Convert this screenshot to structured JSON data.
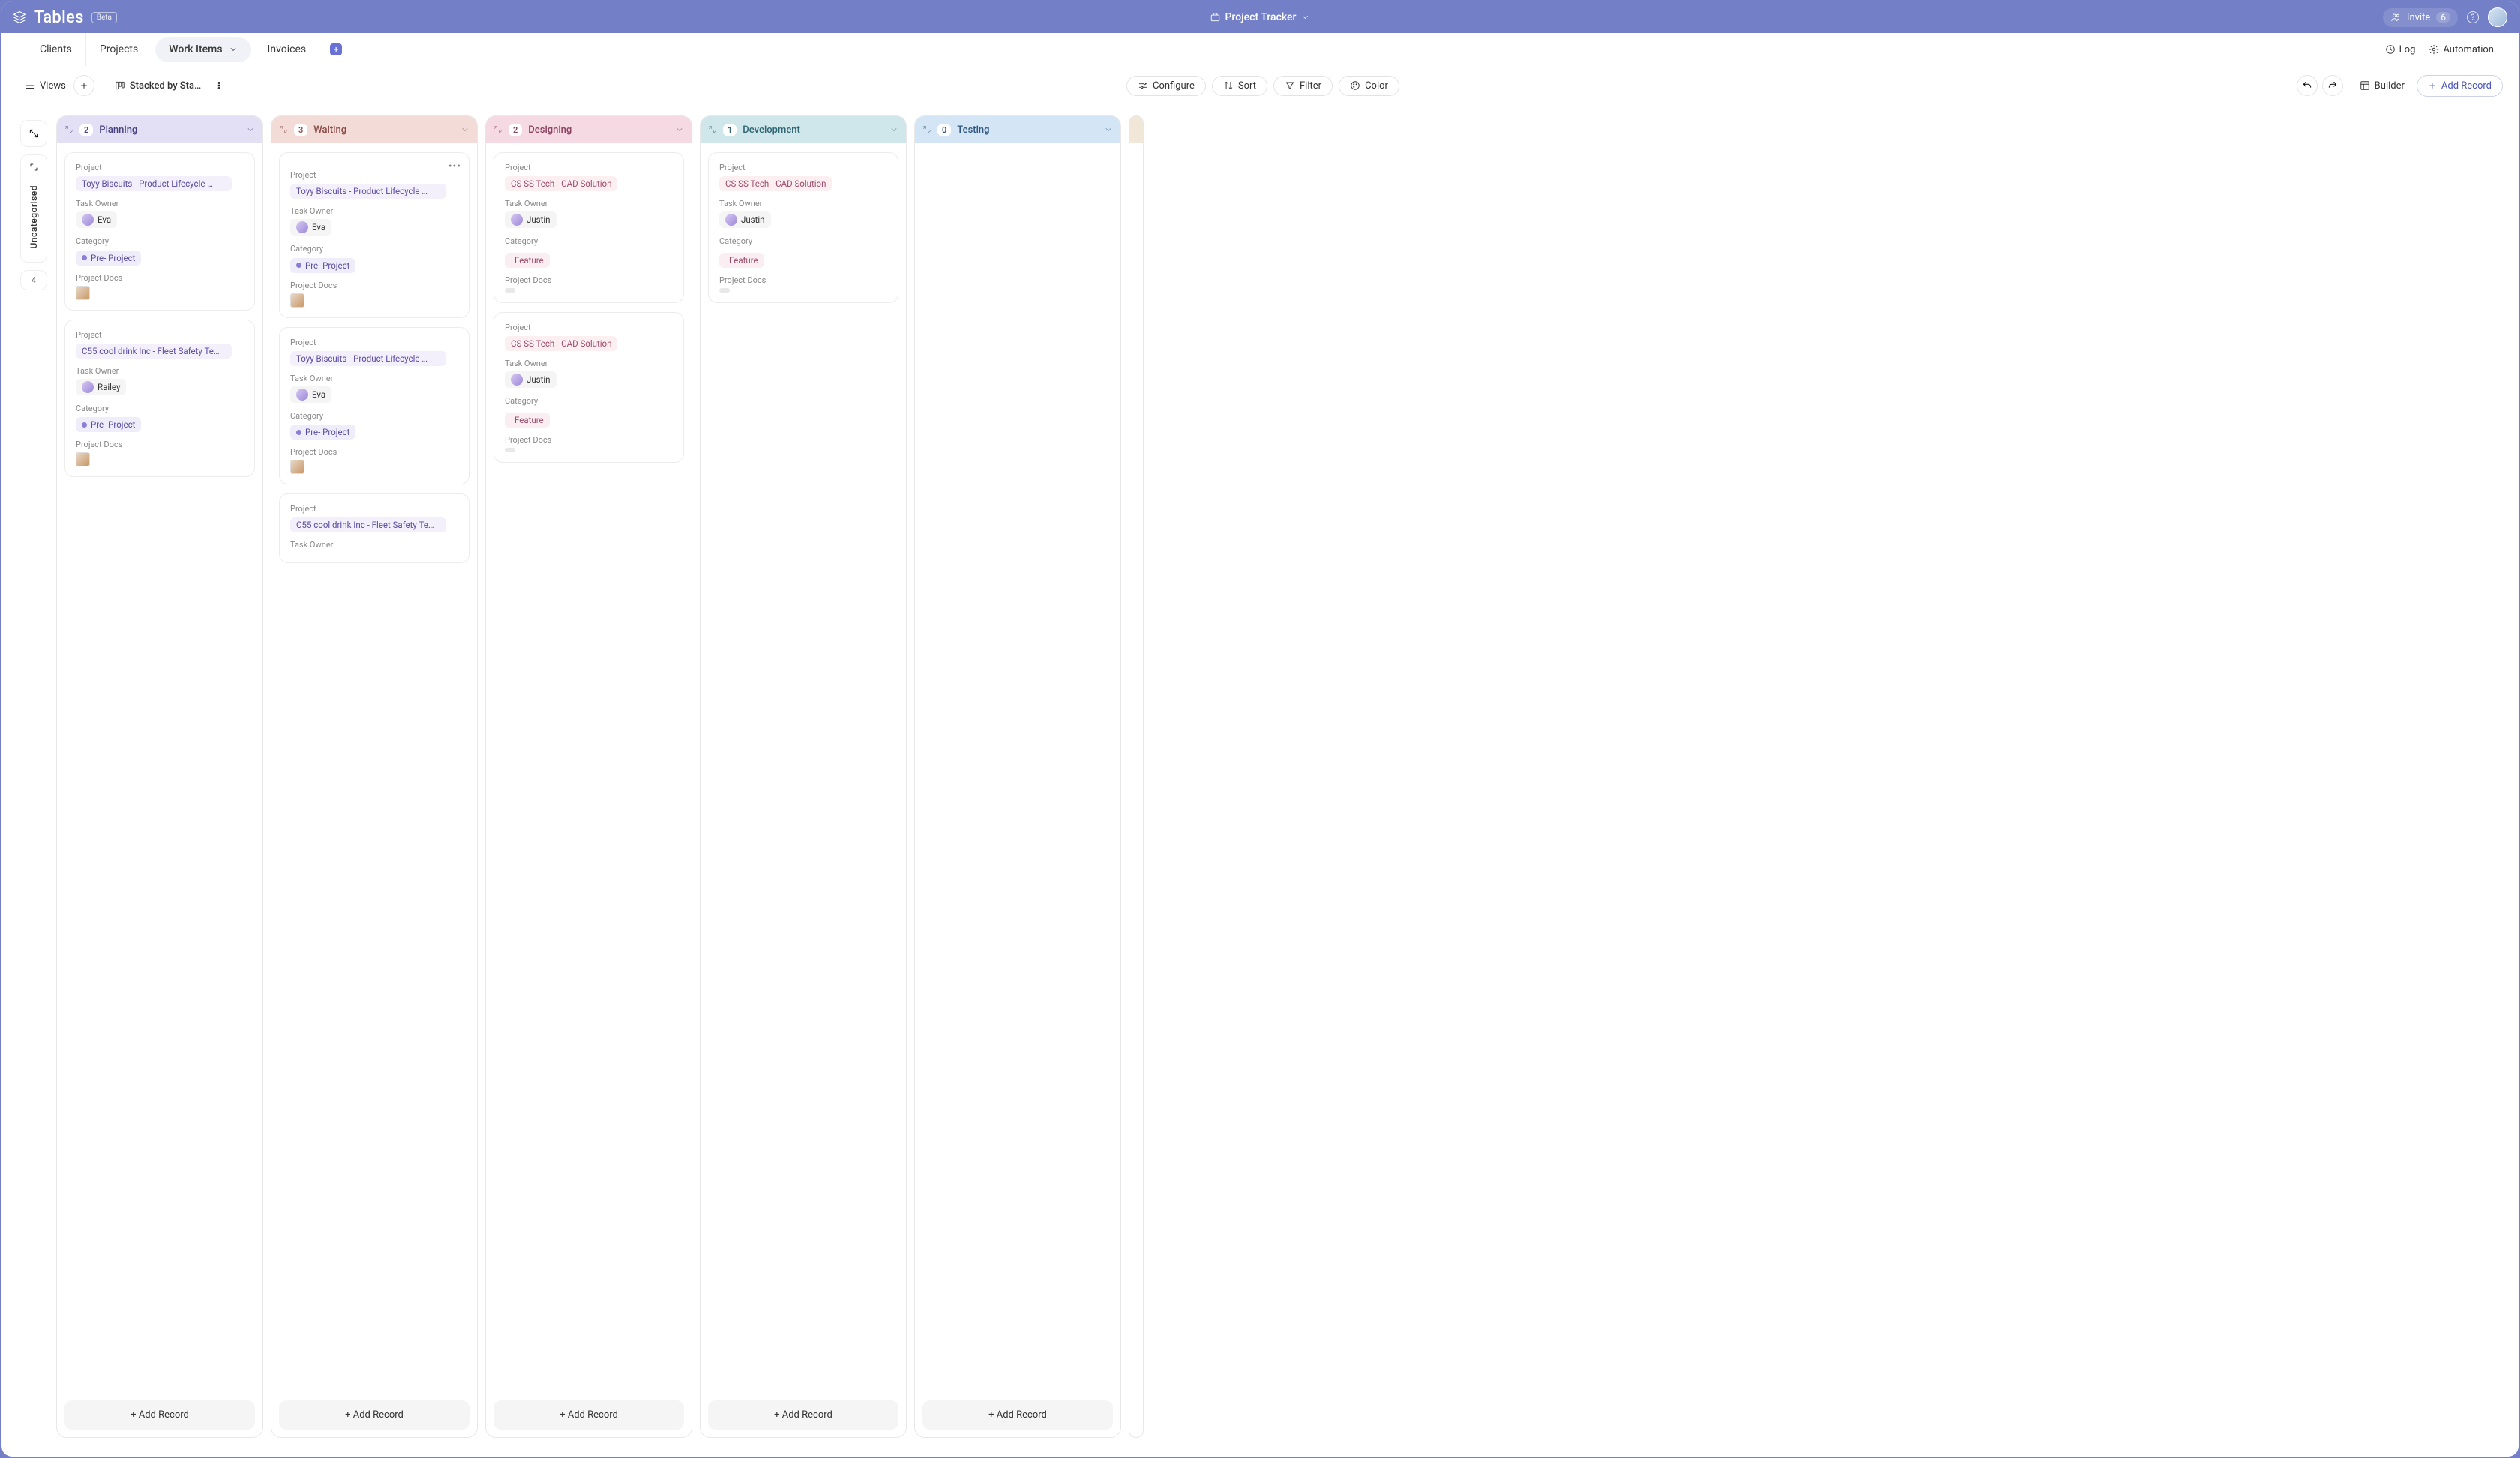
{
  "header": {
    "app_title": "Tables",
    "beta": "Beta",
    "project_name": "Project Tracker",
    "invite_label": "Invite",
    "invite_count": "6"
  },
  "tabs": {
    "items": [
      {
        "label": "Clients"
      },
      {
        "label": "Projects"
      },
      {
        "label": "Work Items",
        "active": true
      },
      {
        "label": "Invoices"
      }
    ],
    "log": "Log",
    "automation": "Automation"
  },
  "toolbar": {
    "views": "Views",
    "view_name": "Stacked by Sta…",
    "configure": "Configure",
    "sort": "Sort",
    "filter": "Filter",
    "color": "Color",
    "builder": "Builder",
    "add_record": "Add Record"
  },
  "field_labels": {
    "project": "Project",
    "task_owner": "Task Owner",
    "category": "Category",
    "project_docs": "Project Docs"
  },
  "sidebar": {
    "label": "Uncategorised",
    "count": "4"
  },
  "columns": [
    {
      "title": "Planning",
      "count": "2",
      "cls": "planning",
      "cards": [
        {
          "project": "Toyy Biscuits - Product Lifecycle …",
          "proj_cls": "proj",
          "owner": "Eva",
          "cat": "Pre- Project",
          "cat_cls": "cat",
          "doc": "thumb"
        },
        {
          "project": "C55 cool drink Inc - Fleet Safety Te…",
          "proj_cls": "proj",
          "owner": "Railey",
          "cat": "Pre- Project",
          "cat_cls": "cat",
          "doc": "thumb"
        }
      ]
    },
    {
      "title": "Waiting",
      "count": "3",
      "cls": "waiting",
      "cards": [
        {
          "project": "Toyy Biscuits - Product Lifecycle …",
          "proj_cls": "proj",
          "owner": "Eva",
          "cat": "Pre- Project",
          "cat_cls": "cat",
          "doc": "thumb",
          "more": true
        },
        {
          "project": "Toyy Biscuits - Product Lifecycle …",
          "proj_cls": "proj",
          "owner": "Eva",
          "cat": "Pre- Project",
          "cat_cls": "cat",
          "doc": "thumb"
        },
        {
          "project": "C55 cool drink Inc - Fleet Safety Te…",
          "proj_cls": "proj",
          "owner": "",
          "cat": "",
          "cat_cls": "",
          "doc": "",
          "partial": true
        }
      ]
    },
    {
      "title": "Designing",
      "count": "2",
      "cls": "designing",
      "cards": [
        {
          "project": "CS SS Tech - CAD Solution",
          "proj_cls": "proj-pink",
          "owner": "Justin",
          "cat": "Feature",
          "cat_cls": "cat-pink",
          "doc": "empty"
        },
        {
          "project": "CS SS Tech - CAD Solution",
          "proj_cls": "proj-pink",
          "owner": "Justin",
          "cat": "Feature",
          "cat_cls": "cat-pink",
          "doc": "empty"
        }
      ]
    },
    {
      "title": "Development",
      "count": "1",
      "cls": "development",
      "cards": [
        {
          "project": "CS SS Tech - CAD Solution",
          "proj_cls": "proj-pink",
          "owner": "Justin",
          "cat": "Feature",
          "cat_cls": "cat-pink",
          "doc": "empty"
        }
      ]
    },
    {
      "title": "Testing",
      "count": "0",
      "cls": "testing",
      "cards": []
    }
  ],
  "add_record_btn": "+ Add Record"
}
